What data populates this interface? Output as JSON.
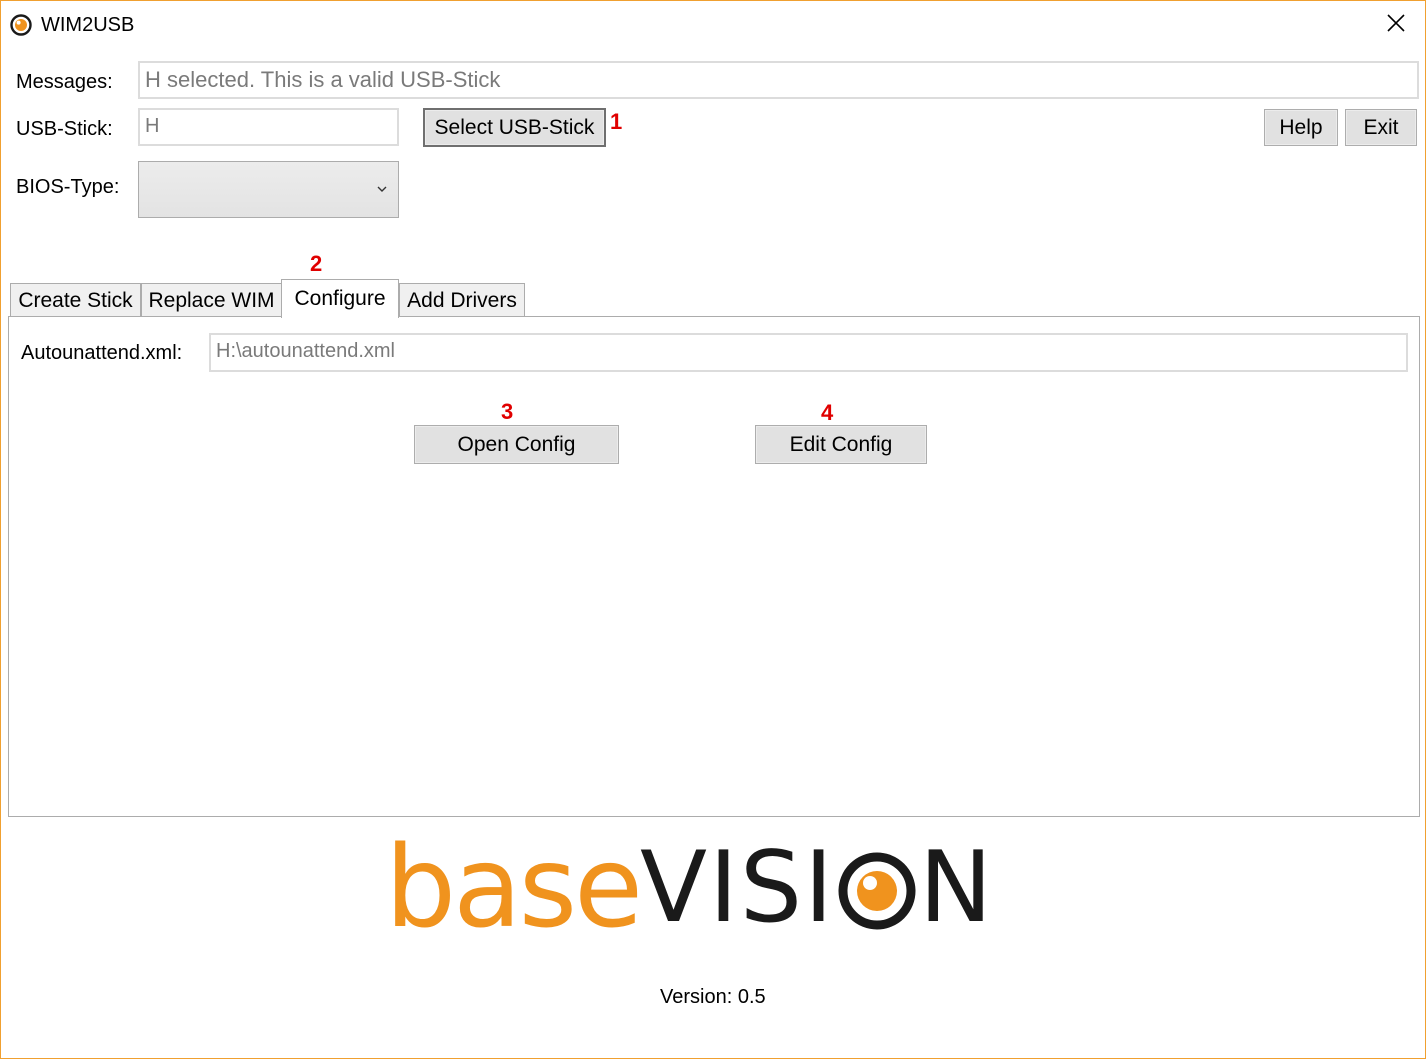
{
  "window": {
    "title": "WIM2USB",
    "accent_color": "#f0931e"
  },
  "icons": {
    "app": "basevision-eye-icon",
    "close": "close-icon",
    "dropdown": "chevron-down-icon"
  },
  "form": {
    "messages_label": "Messages:",
    "messages_value": "H selected. This is a valid USB-Stick",
    "usb_label": "USB-Stick:",
    "usb_value": "H",
    "select_usb_label": "Select USB-Stick",
    "help_label": "Help",
    "exit_label": "Exit",
    "bios_label": "BIOS-Type:",
    "bios_value": ""
  },
  "markers": [
    "1",
    "2",
    "3",
    "4"
  ],
  "tabs": [
    {
      "label": "Create Stick",
      "active": false
    },
    {
      "label": "Replace WIM",
      "active": false
    },
    {
      "label": "Configure",
      "active": true
    },
    {
      "label": "Add Drivers",
      "active": false
    }
  ],
  "configure": {
    "autounattend_label": "Autounattend.xml:",
    "autounattend_value": "H:\\autounattend.xml",
    "open_config_label": "Open Config",
    "edit_config_label": "Edit Config"
  },
  "logo": {
    "part1": "base",
    "part2_pre": "VISI",
    "part2_post": "N",
    "part1_color": "#f0931e",
    "part2_color": "#1a1a1a"
  },
  "footer": {
    "version": "Version: 0.5"
  }
}
